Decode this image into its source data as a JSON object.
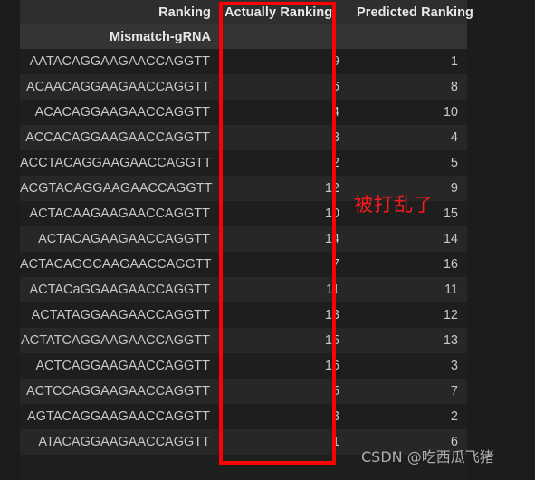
{
  "table": {
    "header": {
      "ranking_label": "Ranking",
      "actually_label": "Actually Ranking",
      "predicted_label": "Predicted Ranking",
      "mismatch_label": "Mismatch-gRNA"
    },
    "columns": [
      "Mismatch-gRNA",
      "Actually Ranking",
      "Predicted Ranking"
    ],
    "rows": [
      {
        "sequence": "AATACAGGAAGAACCAGGTT",
        "actually": "9",
        "predicted": "1"
      },
      {
        "sequence": "ACAACAGGAAGAACCAGGTT",
        "actually": "6",
        "predicted": "8"
      },
      {
        "sequence": "ACACAGGAAGAACCAGGTT",
        "actually": "4",
        "predicted": "10"
      },
      {
        "sequence": "ACCACAGGAAGAACCAGGTT",
        "actually": "8",
        "predicted": "4"
      },
      {
        "sequence": "ACCTACAGGAAGAACCAGGTT",
        "actually": "2",
        "predicted": "5"
      },
      {
        "sequence": "ACGTACAGGAAGAACCAGGTT",
        "actually": "12",
        "predicted": "9"
      },
      {
        "sequence": "ACTACAAGAAGAACCAGGTT",
        "actually": "10",
        "predicted": "15"
      },
      {
        "sequence": "ACTACAGAAGAACCAGGTT",
        "actually": "14",
        "predicted": "14"
      },
      {
        "sequence": "ACTACAGGCAAGAACCAGGTT",
        "actually": "7",
        "predicted": "16"
      },
      {
        "sequence": "ACTACaGGAAGAACCAGGTT",
        "actually": "11",
        "predicted": "11"
      },
      {
        "sequence": "ACTATAGGAAGAACCAGGTT",
        "actually": "13",
        "predicted": "12"
      },
      {
        "sequence": "ACTATCAGGAAGAACCAGGTT",
        "actually": "15",
        "predicted": "13"
      },
      {
        "sequence": "ACTCAGGAAGAACCAGGTT",
        "actually": "16",
        "predicted": "3"
      },
      {
        "sequence": "ACTCCAGGAAGAACCAGGTT",
        "actually": "5",
        "predicted": "7"
      },
      {
        "sequence": "AGTACAGGAAGAACCAGGTT",
        "actually": "3",
        "predicted": "2"
      },
      {
        "sequence": "ATACAGGAAGAACCAGGTT",
        "actually": "1",
        "predicted": "6"
      }
    ]
  },
  "annotations": {
    "shuffled_note": "被打乱了",
    "highlight_color": "#fe0000",
    "note_color": "#ff1a1a"
  },
  "watermark": {
    "text": "CSDN @吃西瓜飞猪"
  }
}
